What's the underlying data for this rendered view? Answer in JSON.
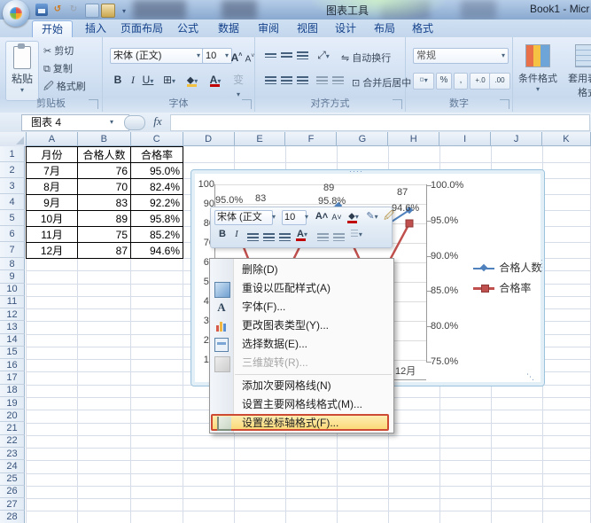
{
  "window": {
    "chart_tools": "图表工具",
    "title": "Book1 - Micr",
    "qat_icons": [
      "office-button",
      "save",
      "undo",
      "redo",
      "switch-windows",
      "chart-wizard",
      "customize-dropdown"
    ]
  },
  "tabs": [
    {
      "label": "开始",
      "active": true
    },
    {
      "label": "插入",
      "active": false
    },
    {
      "label": "页面布局",
      "active": false
    },
    {
      "label": "公式",
      "active": false
    },
    {
      "label": "数据",
      "active": false
    },
    {
      "label": "审阅",
      "active": false
    },
    {
      "label": "视图",
      "active": false
    },
    {
      "label": "设计",
      "active": false
    },
    {
      "label": "布局",
      "active": false
    },
    {
      "label": "格式",
      "active": false
    }
  ],
  "ribbon": {
    "clipboard": {
      "label": "剪贴板",
      "paste": "粘贴",
      "cut": "剪切",
      "copy": "复制",
      "format_painter": "格式刷"
    },
    "font": {
      "label": "字体",
      "font_name": "宋体 (正文)",
      "font_size": "10",
      "bold": "B",
      "italic": "I",
      "underline": "U",
      "grow": "A",
      "shrink": "A",
      "color_letter": "A"
    },
    "alignment": {
      "label": "对齐方式",
      "wrap_text": "自动换行",
      "merge_center": "合并后居中"
    },
    "number": {
      "label": "数字",
      "format": "常规",
      "percent": "%",
      "comma": ",",
      "inc_decimal": "+.0",
      "dec_decimal": ".00"
    },
    "styles": {
      "conditional": "条件格式",
      "format_table": "套用表格格式"
    }
  },
  "formula_bar": {
    "name_box": "图表 4",
    "fx": "fx"
  },
  "sheet": {
    "columns": [
      "A",
      "B",
      "C",
      "D",
      "E",
      "F",
      "G",
      "H",
      "I",
      "J",
      "K"
    ],
    "row_numbers": [
      1,
      2,
      3,
      4,
      5,
      6,
      7,
      8,
      9,
      10,
      11,
      12,
      13,
      14,
      15,
      16,
      17,
      18,
      19,
      20,
      21,
      22,
      23,
      24,
      25,
      26,
      27,
      28
    ],
    "table": {
      "headers": [
        "月份",
        "合格人数",
        "合格率"
      ],
      "rows": [
        [
          "7月",
          "76",
          "95.0%"
        ],
        [
          "8月",
          "70",
          "82.4%"
        ],
        [
          "9月",
          "83",
          "92.2%"
        ],
        [
          "10月",
          "89",
          "95.8%"
        ],
        [
          "11月",
          "75",
          "85.2%"
        ],
        [
          "12月",
          "87",
          "94.6%"
        ]
      ]
    }
  },
  "chart": {
    "left_axis": [
      "100",
      "90",
      "80",
      "70",
      "60",
      "50",
      "40",
      "30",
      "20",
      "10"
    ],
    "right_axis": [
      "100.0%",
      "95.0%",
      "90.0%",
      "85.0%",
      "80.0%",
      "75.0%"
    ],
    "x_tick": "12月",
    "data_labels": [
      "95.0%",
      "83",
      "89",
      "95.8%",
      "87",
      "94.6%"
    ],
    "legend": [
      "合格人数",
      "合格率"
    ],
    "series_colors": {
      "line1": "#4F81BD",
      "line2": "#C0504D"
    }
  },
  "chart_data": {
    "type": "line",
    "categories": [
      "7月",
      "8月",
      "9月",
      "10月",
      "11月",
      "12月"
    ],
    "series": [
      {
        "name": "合格人数",
        "axis": "left",
        "values": [
          76,
          70,
          83,
          89,
          75,
          87
        ]
      },
      {
        "name": "合格率",
        "axis": "right",
        "values_percent": [
          95.0,
          82.4,
          92.2,
          95.8,
          85.2,
          94.6
        ]
      }
    ],
    "left_axis_range": [
      0,
      100
    ],
    "right_axis_range": [
      75,
      100
    ],
    "grid": true,
    "legend_position": "right"
  },
  "mini_toolbar": {
    "font_name": "宋体 (正文",
    "font_size": "10",
    "bold": "B",
    "italic": "I",
    "color_letter": "A"
  },
  "context_menu": {
    "items": [
      {
        "label": "删除(D)",
        "state": "normal"
      },
      {
        "label": "重设以匹配样式(A)",
        "state": "normal"
      },
      {
        "label": "字体(F)...",
        "state": "normal"
      },
      {
        "label": "更改图表类型(Y)...",
        "state": "normal"
      },
      {
        "label": "选择数据(E)...",
        "state": "normal"
      },
      {
        "label": "三维旋转(R)...",
        "state": "disabled"
      },
      {
        "label": "添加次要网格线(N)",
        "state": "normal"
      },
      {
        "label": "设置主要网格线格式(M)...",
        "state": "normal"
      },
      {
        "label": "设置坐标轴格式(F)...",
        "state": "highlighted"
      }
    ]
  },
  "glyphs": {
    "dropdown": "▾",
    "handle_dots": "····"
  }
}
